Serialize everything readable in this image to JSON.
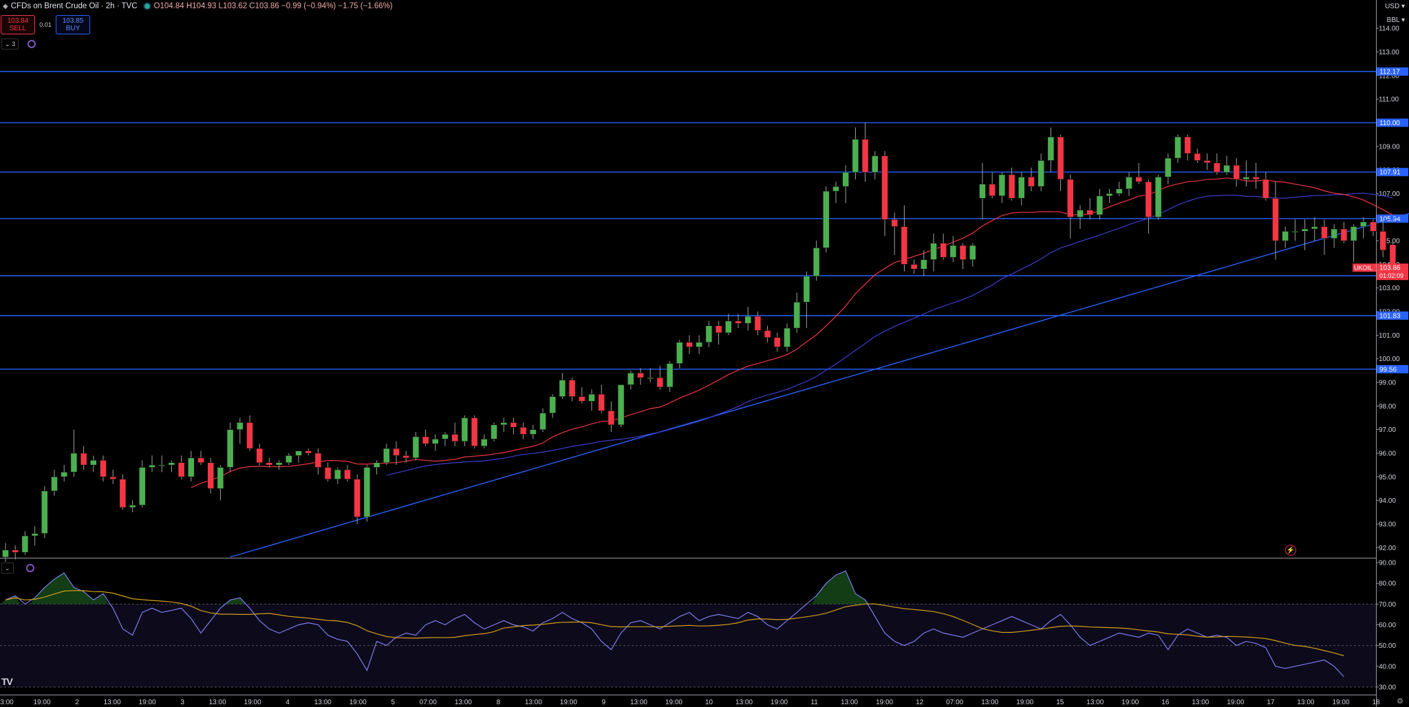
{
  "header": {
    "title": "CFDs on Brent Crude Oil · 2h · TVC",
    "ohlc": "O104.84 H104.93 L103.62 C103.86 −0.99 (−0.94%) −1.75 (−1.66%)"
  },
  "trade": {
    "sell_price": "103.84",
    "sell_label": "SELL",
    "spread": "0.01",
    "buy_price": "103.85",
    "buy_label": "BUY"
  },
  "indicators_toggle": "3",
  "currency": "USD",
  "unit": "BBL",
  "logo": "TV",
  "colors": {
    "up": "#4caf50",
    "down": "#f23645",
    "hline": "#2962ff",
    "ma_fast": "#f23645",
    "ma_slow": "#3d3dcf",
    "rsi": "#7e7ef0",
    "rsi_ma": "#d4a017"
  },
  "chart_data": [
    {
      "type": "candlestick",
      "ylim": [
        91.6,
        115.2
      ],
      "y_ticks": [
        92,
        93,
        94,
        95,
        96,
        97,
        98,
        99,
        100,
        101,
        102,
        103,
        104,
        105,
        106,
        107,
        108,
        109,
        110,
        111,
        112,
        113,
        114
      ],
      "y_tick_labels": [
        "92.00",
        "93.00",
        "94.00",
        "95.00",
        "96.00",
        "97.00",
        "98.00",
        "99.00",
        "100.00",
        "101.00",
        "102.00",
        "103.00",
        "104.00",
        "105.00",
        "106.00",
        "107.00",
        "108.00",
        "109.00",
        "110.00",
        "111.00",
        "112.00",
        "113.00",
        "114.00"
      ],
      "x_labels": [
        "3:00",
        "19:00",
        "2",
        "13:00",
        "19:00",
        "3",
        "13:00",
        "19:00",
        "4",
        "13:00",
        "19:00",
        "5",
        "07:00",
        "13:00",
        "8",
        "13:00",
        "19:00",
        "9",
        "13:00",
        "19:00",
        "10",
        "13:00",
        "19:00",
        "11",
        "13:00",
        "19:00",
        "12",
        "07:00",
        "13:00",
        "19:00",
        "15",
        "13:00",
        "19:00",
        "16",
        "13:00",
        "19:00",
        "17",
        "13:00",
        "19:00",
        "18"
      ],
      "candles": [
        [
          91.6,
          92.2,
          91.4,
          91.9
        ],
        [
          91.9,
          92.1,
          91.5,
          91.8
        ],
        [
          91.8,
          92.7,
          91.7,
          92.5
        ],
        [
          92.5,
          92.9,
          92.1,
          92.6
        ],
        [
          92.6,
          94.6,
          92.4,
          94.4
        ],
        [
          94.4,
          95.3,
          94.2,
          95.0
        ],
        [
          95.0,
          95.5,
          94.8,
          95.2
        ],
        [
          95.2,
          97.0,
          95.0,
          96.0
        ],
        [
          96.0,
          96.3,
          95.3,
          95.5
        ],
        [
          95.5,
          95.9,
          95.2,
          95.7
        ],
        [
          95.7,
          95.9,
          94.8,
          95.0
        ],
        [
          95.0,
          95.3,
          94.7,
          94.9
        ],
        [
          94.9,
          95.1,
          93.6,
          93.7
        ],
        [
          93.7,
          94.0,
          93.5,
          93.8
        ],
        [
          93.8,
          95.7,
          93.7,
          95.4
        ],
        [
          95.4,
          95.9,
          95.2,
          95.5
        ],
        [
          95.5,
          95.9,
          95.2,
          95.5
        ],
        [
          95.5,
          95.7,
          95.2,
          95.6
        ],
        [
          95.6,
          95.9,
          94.9,
          95.0
        ],
        [
          95.0,
          96.1,
          94.8,
          95.8
        ],
        [
          95.8,
          96.1,
          95.5,
          95.6
        ],
        [
          95.6,
          95.8,
          94.3,
          94.5
        ],
        [
          94.5,
          95.5,
          94.0,
          95.4
        ],
        [
          95.4,
          97.3,
          95.2,
          97.0
        ],
        [
          97.0,
          97.5,
          96.4,
          97.3
        ],
        [
          97.3,
          97.6,
          96.1,
          96.2
        ],
        [
          96.2,
          96.4,
          95.5,
          95.6
        ],
        [
          95.6,
          95.8,
          95.4,
          95.5
        ],
        [
          95.5,
          95.7,
          95.3,
          95.6
        ],
        [
          95.6,
          96.0,
          95.5,
          95.9
        ],
        [
          95.9,
          96.1,
          95.6,
          96.1
        ],
        [
          96.1,
          96.2,
          95.9,
          96.0
        ],
        [
          96.0,
          96.2,
          95.1,
          95.4
        ],
        [
          95.4,
          95.6,
          94.8,
          94.9
        ],
        [
          94.9,
          95.4,
          94.7,
          95.3
        ],
        [
          95.3,
          95.5,
          94.8,
          94.9
        ],
        [
          94.9,
          95.1,
          93.0,
          93.3
        ],
        [
          93.3,
          95.5,
          93.1,
          95.4
        ],
        [
          95.4,
          95.7,
          95.1,
          95.6
        ],
        [
          95.6,
          96.4,
          95.5,
          96.2
        ],
        [
          96.2,
          96.5,
          95.5,
          95.9
        ],
        [
          95.9,
          96.1,
          95.6,
          95.8
        ],
        [
          95.8,
          96.9,
          95.7,
          96.7
        ],
        [
          96.7,
          97.0,
          96.3,
          96.4
        ],
        [
          96.4,
          96.8,
          96.1,
          96.6
        ],
        [
          96.6,
          96.9,
          96.3,
          96.8
        ],
        [
          96.8,
          97.3,
          96.3,
          96.5
        ],
        [
          96.5,
          97.6,
          96.3,
          97.5
        ],
        [
          97.5,
          97.6,
          96.2,
          96.3
        ],
        [
          96.3,
          96.8,
          96.2,
          96.6
        ],
        [
          96.6,
          97.3,
          96.5,
          97.2
        ],
        [
          97.2,
          97.5,
          96.9,
          97.3
        ],
        [
          97.3,
          97.5,
          96.8,
          97.1
        ],
        [
          97.1,
          97.3,
          96.6,
          96.8
        ],
        [
          96.8,
          97.2,
          96.6,
          97.0
        ],
        [
          97.0,
          97.9,
          96.9,
          97.7
        ],
        [
          97.7,
          98.5,
          97.5,
          98.4
        ],
        [
          98.4,
          99.4,
          98.3,
          99.1
        ],
        [
          99.1,
          99.2,
          98.2,
          98.4
        ],
        [
          98.4,
          98.8,
          98.1,
          98.2
        ],
        [
          98.2,
          98.7,
          97.8,
          98.5
        ],
        [
          98.5,
          98.9,
          97.7,
          97.8
        ],
        [
          97.8,
          98.2,
          96.9,
          97.2
        ],
        [
          97.2,
          98.9,
          97.1,
          98.9
        ],
        [
          98.9,
          99.5,
          98.7,
          99.4
        ],
        [
          99.4,
          99.6,
          98.9,
          99.2
        ],
        [
          99.2,
          99.6,
          99.0,
          99.2
        ],
        [
          99.2,
          99.7,
          98.7,
          98.8
        ],
        [
          98.8,
          99.9,
          98.6,
          99.8
        ],
        [
          99.8,
          100.8,
          99.6,
          100.7
        ],
        [
          100.7,
          101.0,
          100.2,
          100.5
        ],
        [
          100.5,
          101.0,
          100.2,
          100.7
        ],
        [
          100.7,
          101.6,
          100.5,
          101.4
        ],
        [
          101.4,
          101.6,
          100.6,
          101.1
        ],
        [
          101.1,
          101.9,
          101.0,
          101.6
        ],
        [
          101.6,
          101.9,
          101.3,
          101.5
        ],
        [
          101.5,
          102.2,
          101.2,
          101.8
        ],
        [
          101.8,
          102.0,
          101.0,
          101.2
        ],
        [
          101.2,
          101.4,
          100.7,
          100.9
        ],
        [
          100.9,
          101.1,
          100.3,
          100.5
        ],
        [
          100.5,
          101.5,
          100.3,
          101.3
        ],
        [
          101.3,
          102.8,
          101.1,
          102.4
        ],
        [
          102.4,
          103.7,
          101.3,
          103.5
        ],
        [
          103.5,
          105.0,
          103.3,
          104.7
        ],
        [
          104.7,
          107.3,
          104.5,
          107.1
        ],
        [
          107.1,
          107.5,
          106.6,
          107.3
        ],
        [
          107.3,
          108.2,
          106.6,
          107.9
        ],
        [
          107.9,
          109.8,
          107.6,
          109.3
        ],
        [
          109.3,
          110.0,
          107.5,
          107.9
        ],
        [
          107.9,
          108.8,
          107.6,
          108.6
        ],
        [
          108.6,
          108.8,
          105.2,
          105.9
        ],
        [
          105.9,
          106.2,
          104.4,
          105.6
        ],
        [
          105.6,
          106.5,
          103.7,
          104.0
        ],
        [
          104.0,
          104.2,
          103.6,
          103.8
        ],
        [
          103.8,
          104.6,
          103.5,
          104.2
        ],
        [
          104.2,
          105.3,
          103.7,
          104.9
        ],
        [
          104.9,
          105.3,
          104.2,
          104.3
        ],
        [
          104.3,
          105.2,
          104.1,
          104.8
        ],
        [
          104.8,
          104.9,
          103.8,
          104.2
        ],
        [
          104.2,
          104.9,
          103.9,
          104.8
        ],
        [
          106.8,
          108.3,
          105.9,
          107.4
        ],
        [
          107.4,
          107.9,
          106.8,
          106.9
        ],
        [
          106.9,
          107.9,
          106.6,
          107.8
        ],
        [
          107.8,
          108.1,
          106.7,
          106.8
        ],
        [
          106.8,
          107.9,
          106.5,
          107.7
        ],
        [
          107.7,
          108.1,
          107.1,
          107.3
        ],
        [
          107.3,
          108.7,
          107.1,
          108.4
        ],
        [
          108.4,
          109.8,
          107.9,
          109.4
        ],
        [
          109.4,
          109.5,
          107.1,
          107.6
        ],
        [
          107.6,
          107.8,
          105.1,
          106.0
        ],
        [
          106.0,
          106.5,
          105.5,
          106.3
        ],
        [
          106.3,
          106.8,
          105.9,
          106.1
        ],
        [
          106.1,
          107.2,
          105.9,
          106.9
        ],
        [
          106.9,
          107.2,
          106.6,
          107.0
        ],
        [
          107.0,
          107.5,
          106.9,
          107.2
        ],
        [
          107.2,
          107.9,
          106.9,
          107.7
        ],
        [
          107.7,
          108.3,
          107.4,
          107.5
        ],
        [
          107.5,
          107.6,
          105.3,
          106.0
        ],
        [
          106.0,
          107.8,
          105.9,
          107.7
        ],
        [
          107.7,
          108.7,
          107.4,
          108.5
        ],
        [
          108.5,
          109.5,
          108.3,
          109.4
        ],
        [
          109.4,
          109.5,
          108.4,
          108.7
        ],
        [
          108.7,
          108.9,
          108.3,
          108.4
        ],
        [
          108.4,
          108.7,
          108.0,
          108.3
        ],
        [
          108.3,
          108.7,
          107.8,
          107.9
        ],
        [
          107.9,
          108.6,
          107.8,
          108.2
        ],
        [
          108.2,
          108.5,
          107.3,
          107.6
        ],
        [
          107.6,
          108.4,
          107.3,
          107.7
        ],
        [
          107.7,
          108.3,
          107.2,
          107.6
        ],
        [
          107.6,
          107.9,
          106.7,
          106.8
        ],
        [
          106.8,
          107.5,
          104.2,
          105.0
        ],
        [
          105.0,
          105.6,
          104.7,
          105.4
        ],
        [
          105.4,
          105.9,
          105.0,
          105.4
        ],
        [
          105.4,
          105.9,
          104.6,
          105.5
        ],
        [
          105.5,
          106.0,
          105.0,
          105.6
        ],
        [
          105.6,
          105.9,
          104.4,
          105.1
        ],
        [
          105.1,
          105.7,
          104.7,
          105.5
        ],
        [
          105.5,
          105.8,
          104.9,
          105.0
        ],
        [
          105.0,
          105.7,
          104.1,
          105.6
        ],
        [
          105.6,
          106.0,
          105.1,
          105.8
        ],
        [
          105.8,
          105.9,
          105.2,
          105.4
        ],
        [
          105.4,
          105.9,
          104.3,
          104.6
        ],
        [
          104.84,
          104.93,
          103.62,
          103.86
        ]
      ],
      "horizontal_levels": [
        112.17,
        110.0,
        107.91,
        105.94,
        103.52,
        101.83,
        99.56
      ],
      "current_price": {
        "symbol": "UKOIL",
        "price": "103.86",
        "countdown": "01:02:09"
      },
      "trendline": {
        "start": [
          23,
          91.6
        ],
        "end": [
          159,
          108.0
        ]
      }
    },
    {
      "type": "line",
      "name": "RSI",
      "ylim": [
        27,
        90
      ],
      "y_ticks": [
        30,
        40,
        50,
        60,
        70,
        80,
        90
      ],
      "y_tick_labels": [
        "30.00",
        "40.00",
        "50.00",
        "60.00",
        "70.00",
        "80.00",
        "90.00"
      ],
      "bands": [
        30,
        50,
        70
      ],
      "rsi": [
        72,
        74,
        70,
        73,
        78,
        82,
        85,
        78,
        76,
        72,
        75,
        68,
        58,
        55,
        66,
        68,
        66,
        67,
        68,
        63,
        56,
        62,
        68,
        72,
        73,
        68,
        62,
        58,
        56,
        58,
        60,
        61,
        60,
        55,
        53,
        52,
        46,
        38,
        52,
        50,
        54,
        56,
        55,
        60,
        62,
        60,
        63,
        65,
        61,
        58,
        60,
        62,
        60,
        59,
        57,
        61,
        63,
        66,
        63,
        61,
        58,
        52,
        48,
        56,
        61,
        62,
        60,
        58,
        61,
        64,
        66,
        62,
        64,
        65,
        64,
        63,
        66,
        64,
        60,
        58,
        62,
        66,
        70,
        74,
        80,
        84,
        86,
        75,
        72,
        64,
        56,
        52,
        50,
        52,
        56,
        58,
        56,
        55,
        54,
        56,
        58,
        60,
        62,
        64,
        62,
        60,
        58,
        62,
        65,
        60,
        54,
        50,
        52,
        54,
        56,
        55,
        54,
        56,
        55,
        48,
        55,
        58,
        56,
        54,
        55,
        54,
        50,
        52,
        51,
        49,
        40,
        39,
        40,
        41,
        42,
        43,
        40,
        35
      ]
    }
  ]
}
